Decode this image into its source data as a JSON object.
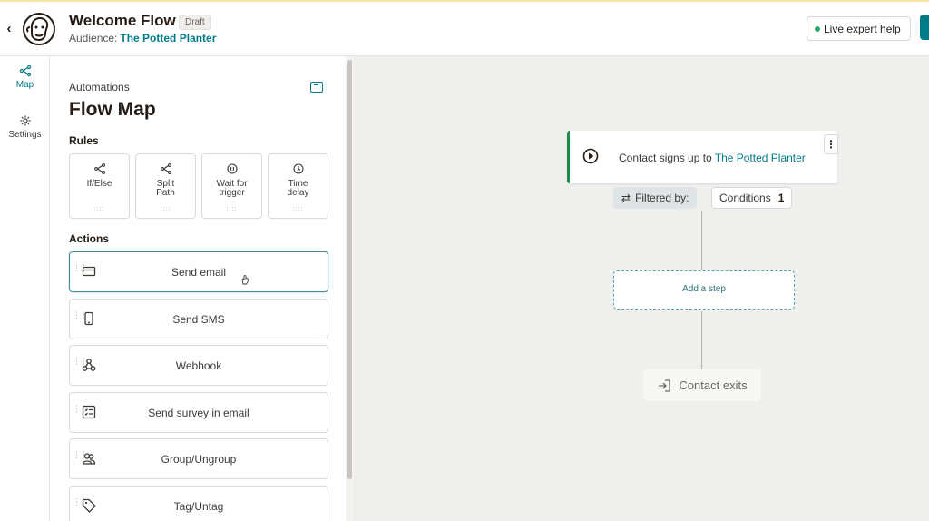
{
  "header": {
    "back_icon": "chevron-left-icon",
    "logo": "mailchimp-freddie-logo",
    "title": "Welcome Flow",
    "status_badge": "Draft",
    "audience_label": "Audience:",
    "audience_name": "The Potted Planter",
    "live_help_label": "Live expert help",
    "live_dot_color": "#2fa66b",
    "accent_color": "#007c89"
  },
  "leftnav": {
    "items": [
      {
        "label": "Map",
        "icon": "map-branch-icon",
        "active": true
      },
      {
        "label": "Settings",
        "icon": "gear-icon",
        "active": false
      }
    ]
  },
  "panel": {
    "eyebrow": "Automations",
    "title": "Flow Map",
    "rules_heading": "Rules",
    "rules": [
      {
        "label": "If/Else",
        "icon": "branch-icon"
      },
      {
        "label": "Split Path",
        "icon": "split-icon"
      },
      {
        "label": "Wait for trigger",
        "icon": "pause-circle-icon"
      },
      {
        "label": "Time delay",
        "icon": "clock-icon"
      }
    ],
    "actions_heading": "Actions",
    "actions": [
      {
        "label": "Send email",
        "icon": "envelope-icon"
      },
      {
        "label": "Send SMS",
        "icon": "phone-icon"
      },
      {
        "label": "Webhook",
        "icon": "webhook-icon"
      },
      {
        "label": "Send survey in email",
        "icon": "survey-icon"
      },
      {
        "label": "Group/Ungroup",
        "icon": "group-icon"
      },
      {
        "label": "Tag/Untag",
        "icon": "tag-icon"
      }
    ]
  },
  "canvas": {
    "trigger_text": "Contact signs up to",
    "trigger_link": "The Potted Planter",
    "filter_label": "Filtered by:",
    "conditions_label": "Conditions",
    "conditions_count": "1",
    "add_step_label": "Add a step",
    "exit_label": "Contact exits",
    "trigger_accent_color": "#1f8a4c"
  }
}
